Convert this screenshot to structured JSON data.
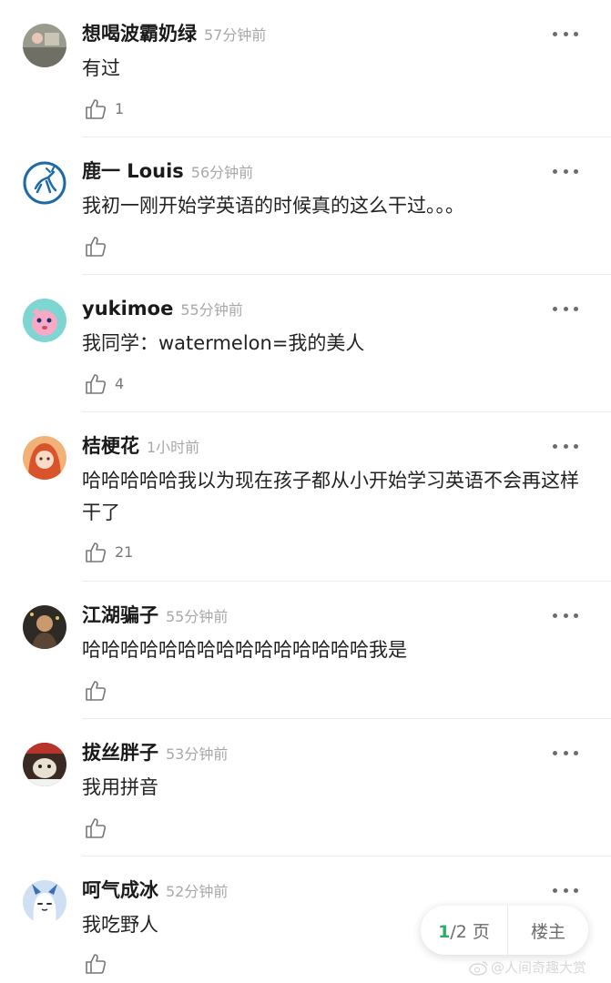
{
  "comments": [
    {
      "user": "想喝波霸奶绿",
      "time": "57分钟前",
      "text": "有过",
      "likes": "1",
      "avatar_color": "#8a8a7c"
    },
    {
      "user": "鹿一 Louis",
      "time": "56分钟前",
      "text": "我初一刚开始学英语的时候真的这么干过。。。",
      "likes": "",
      "avatar_color": "#1c6aa8"
    },
    {
      "user": "yukimoe",
      "time": "55分钟前",
      "text": "我同学：watermelon=我的美人",
      "likes": "4",
      "avatar_color": "#7ed6d3"
    },
    {
      "user": "桔梗花",
      "time": "1小时前",
      "text": "哈哈哈哈哈我以为现在孩子都从小开始学习英语不会再这样干了",
      "likes": "21",
      "avatar_color": "#e0733a"
    },
    {
      "user": "江湖骗子",
      "time": "55分钟前",
      "text": "哈哈哈哈哈哈哈哈哈哈哈哈哈哈哈我是",
      "likes": "",
      "avatar_color": "#3a3530"
    },
    {
      "user": "拔丝胖子",
      "time": "53分钟前",
      "text": "我用拼音",
      "likes": "",
      "avatar_color": "#5a2a22"
    },
    {
      "user": "呵气成冰",
      "time": "52分钟前",
      "text": "我吃野人",
      "likes": "",
      "avatar_color": "#3d6fb0"
    }
  ],
  "pager": {
    "current": "1",
    "total": "/2 页",
    "owner_label": "楼主"
  },
  "watermark": {
    "text": "@人间奇趣大赏",
    "icon": "weibo-icon"
  },
  "icons": {
    "like": "thumbs-up-icon",
    "more": "more-dots-icon"
  },
  "colors": {
    "accent": "#2aae67",
    "meta_gray": "#a8a8a8"
  }
}
